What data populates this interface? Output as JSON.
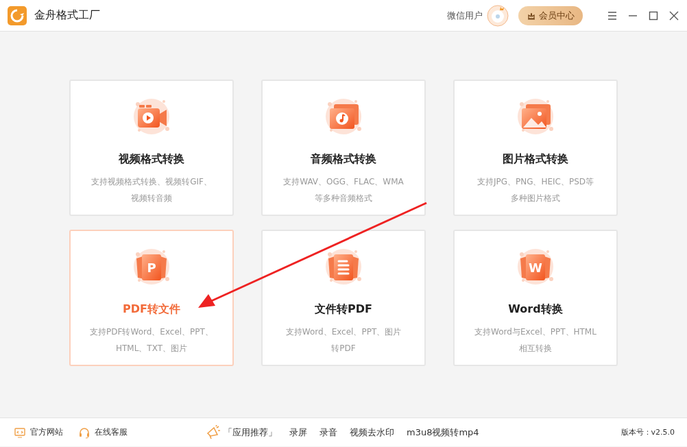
{
  "window": {
    "title": "金舟格式工厂",
    "user": "微信用户",
    "vip_button": "会员中心"
  },
  "cards": [
    {
      "kind": "video",
      "title": "视频格式转换",
      "description": [
        "支持视频格式转换、视频转GIF、",
        "视频转音频"
      ],
      "selected": false
    },
    {
      "kind": "audio",
      "title": "音频格式转换",
      "description": [
        "支持WAV、OGG、FLAC、WMA",
        "等多种音频格式"
      ],
      "selected": false
    },
    {
      "kind": "image",
      "title": "图片格式转换",
      "description": [
        "支持JPG、PNG、HEIC、PSD等",
        "多种图片格式"
      ],
      "selected": false
    },
    {
      "kind": "pdf",
      "glyph": "P",
      "title": "PDF转文件",
      "description": [
        "支持PDF转Word、Excel、PPT、",
        "HTML、TXT、图片"
      ],
      "selected": true
    },
    {
      "kind": "doc",
      "title": "文件转PDF",
      "description": [
        "支持Word、Excel、PPT、图片",
        "转PDF"
      ],
      "selected": false
    },
    {
      "kind": "word",
      "glyph": "W",
      "title": "Word转换",
      "description": [
        "支持Word与Excel、PPT、HTML",
        "相互转换"
      ],
      "selected": false
    }
  ],
  "annotation": {
    "kind": "arrow"
  },
  "status_bar": {
    "left": [
      {
        "kind": "monitor",
        "label": "官方网站"
      },
      {
        "kind": "headset",
        "label": "在线客服"
      }
    ],
    "recommend": "「应用推荐」",
    "apps": [
      "录屏",
      "录音",
      "视频去水印",
      "m3u8视频转mp4"
    ],
    "version": "版本号：v2.5.0"
  }
}
